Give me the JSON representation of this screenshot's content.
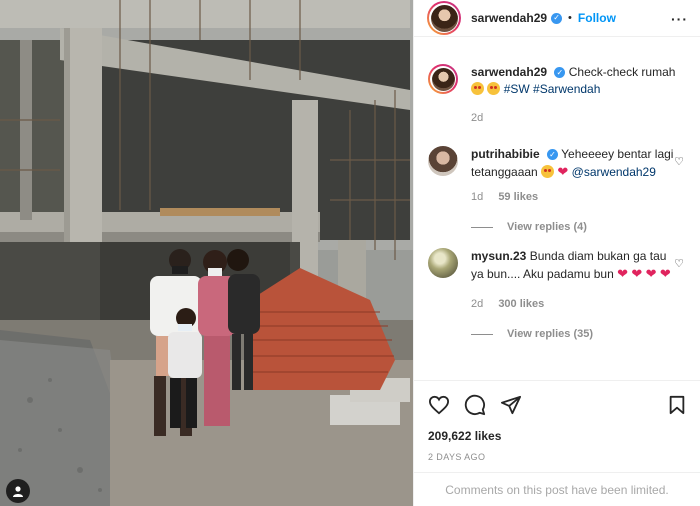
{
  "post": {
    "author": "sarwendah29",
    "dot": "•",
    "follow_label": "Follow",
    "more_icon": "more-dots-icon",
    "caption": {
      "username": "sarwendah29",
      "text": "Check-check rumah",
      "hashtags": "#SW #Sarwendah",
      "time": "2d"
    },
    "comments": [
      {
        "username": "putrihabibie",
        "text_1": "Yeheeeey bentar lagi tetanggaaan",
        "mention": "@sarwendah29",
        "time": "1d",
        "likes": "59 likes",
        "replies": "View replies (4)"
      },
      {
        "username": "mysun.23",
        "text_1": "Bunda diam bukan ga tau ya bun.... Aku padamu bun",
        "time": "2d",
        "likes": "300 likes",
        "replies": "View replies (35)"
      }
    ],
    "likes_count": "209,622 likes",
    "date": "2 DAYS AGO",
    "comments_limited": "Comments on this post have been limited."
  },
  "colors": {
    "link": "#0095f6",
    "verified": "#3897f0",
    "muted": "#8e8e8e",
    "text": "#262626"
  }
}
